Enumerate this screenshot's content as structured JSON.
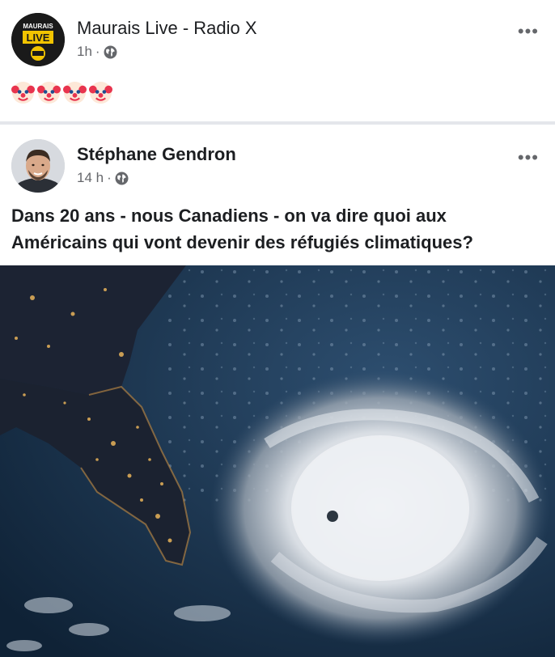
{
  "posts": [
    {
      "author": "Maurais Live - Radio X",
      "avatar_text": {
        "line1": "MAURAIS",
        "line2": "LIVE"
      },
      "time": "1h",
      "separator": "·",
      "privacy_icon": "globe-icon",
      "text": "🤡🤡🤡🤡",
      "emoji_icon": "clown-face-emoji",
      "emoji_count": 4,
      "more_label": "•••"
    },
    {
      "author": "Stéphane Gendron",
      "time": "14 h",
      "separator": "·",
      "privacy_icon": "globe-icon",
      "text": "Dans 20 ans - nous Canadiens - on va dire quoi aux Américains qui vont devenir des réfugiés climatiques?",
      "more_label": "•••",
      "image": "satellite-hurricane-florida-night"
    }
  ],
  "colors": {
    "text_primary": "#1c1e21",
    "text_secondary": "#65676b",
    "divider": "#e4e6eb"
  }
}
